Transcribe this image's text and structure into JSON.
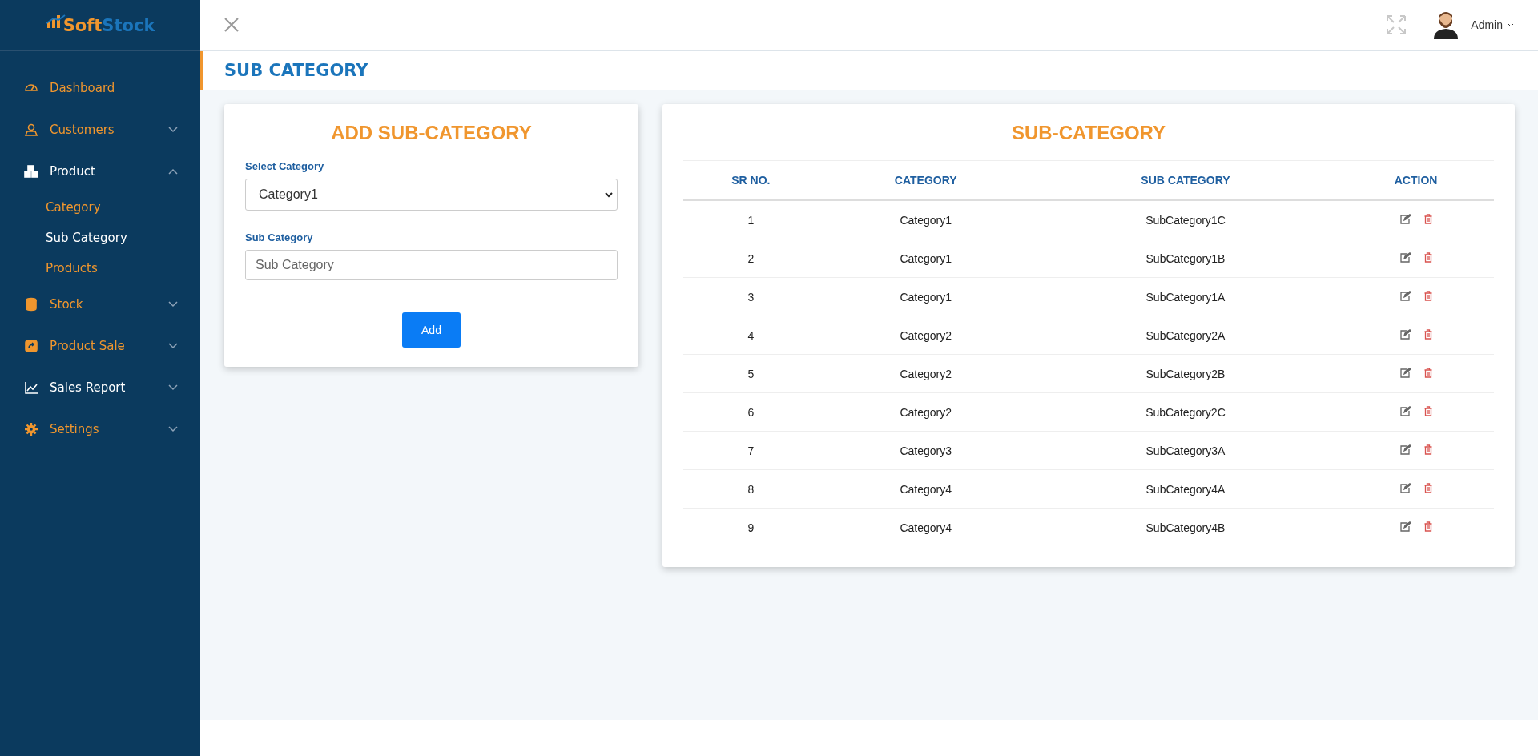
{
  "logo": {
    "part_1": "Soft",
    "part_2": "Stock"
  },
  "sidebar": {
    "items": [
      {
        "label": "Dashboard",
        "active": false
      },
      {
        "label": "Customers",
        "active": false,
        "expanded": false
      },
      {
        "label": "Product",
        "active": true,
        "expanded": true,
        "children": [
          {
            "label": "Category",
            "selected": false
          },
          {
            "label": "Sub Category",
            "selected": true
          },
          {
            "label": "Products",
            "selected": false
          }
        ]
      },
      {
        "label": "Stock",
        "active": false,
        "expanded": false
      },
      {
        "label": "Product Sale",
        "active": false,
        "expanded": false
      },
      {
        "label": "Sales Report",
        "active": true,
        "expanded": false
      },
      {
        "label": "Settings",
        "active": false,
        "expanded": false
      }
    ]
  },
  "topbar": {
    "user": "Admin"
  },
  "page_title": "SUB CATEGORY",
  "form": {
    "title": "ADD SUB-CATEGORY",
    "select_label": "Select Category",
    "select_value": "Category1",
    "input_label": "Sub Category",
    "input_placeholder": "Sub Category",
    "button": "Add"
  },
  "table": {
    "title": "SUB-CATEGORY",
    "columns": [
      "SR NO.",
      "CATEGORY",
      "SUB CATEGORY",
      "ACTION"
    ],
    "rows": [
      [
        "1",
        "Category1",
        "SubCategory1C"
      ],
      [
        "2",
        "Category1",
        "SubCategory1B"
      ],
      [
        "3",
        "Category1",
        "SubCategory1A"
      ],
      [
        "4",
        "Category2",
        "SubCategory2A"
      ],
      [
        "5",
        "Category2",
        "SubCategory2B"
      ],
      [
        "6",
        "Category2",
        "SubCategory2C"
      ],
      [
        "7",
        "Category3",
        "SubCategory3A"
      ],
      [
        "8",
        "Category4",
        "SubCategory4A"
      ],
      [
        "9",
        "Category4",
        "SubCategory4B"
      ]
    ]
  }
}
